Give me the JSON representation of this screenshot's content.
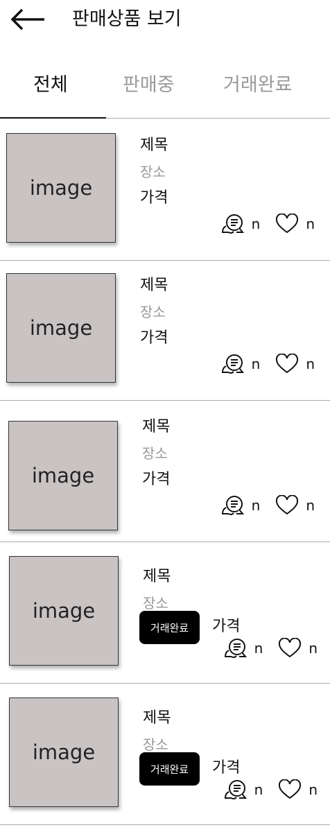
{
  "header": {
    "title": "판매상품 보기",
    "back_icon": "arrow-left-icon"
  },
  "tabs": [
    {
      "label": "전체",
      "active": true
    },
    {
      "label": "판매중",
      "active": false
    },
    {
      "label": "거래완료",
      "active": false
    }
  ],
  "items": [
    {
      "image": "image",
      "title": "제목",
      "location": "장소",
      "price": "가격",
      "badge": null,
      "chats": "n",
      "likes": "n"
    },
    {
      "image": "image",
      "title": "제목",
      "location": "장소",
      "price": "가격",
      "badge": null,
      "chats": "n",
      "likes": "n"
    },
    {
      "image": "image",
      "title": "제목",
      "location": "장소",
      "price": "가격",
      "badge": null,
      "chats": "n",
      "likes": "n"
    },
    {
      "image": "image",
      "title": "제목",
      "location": "장소",
      "price": "가격",
      "badge": "거래완료",
      "chats": "n",
      "likes": "n"
    },
    {
      "image": "image",
      "title": "제목",
      "location": "장소",
      "price": "가격",
      "badge": "거래완료",
      "chats": "n",
      "likes": "n"
    }
  ]
}
